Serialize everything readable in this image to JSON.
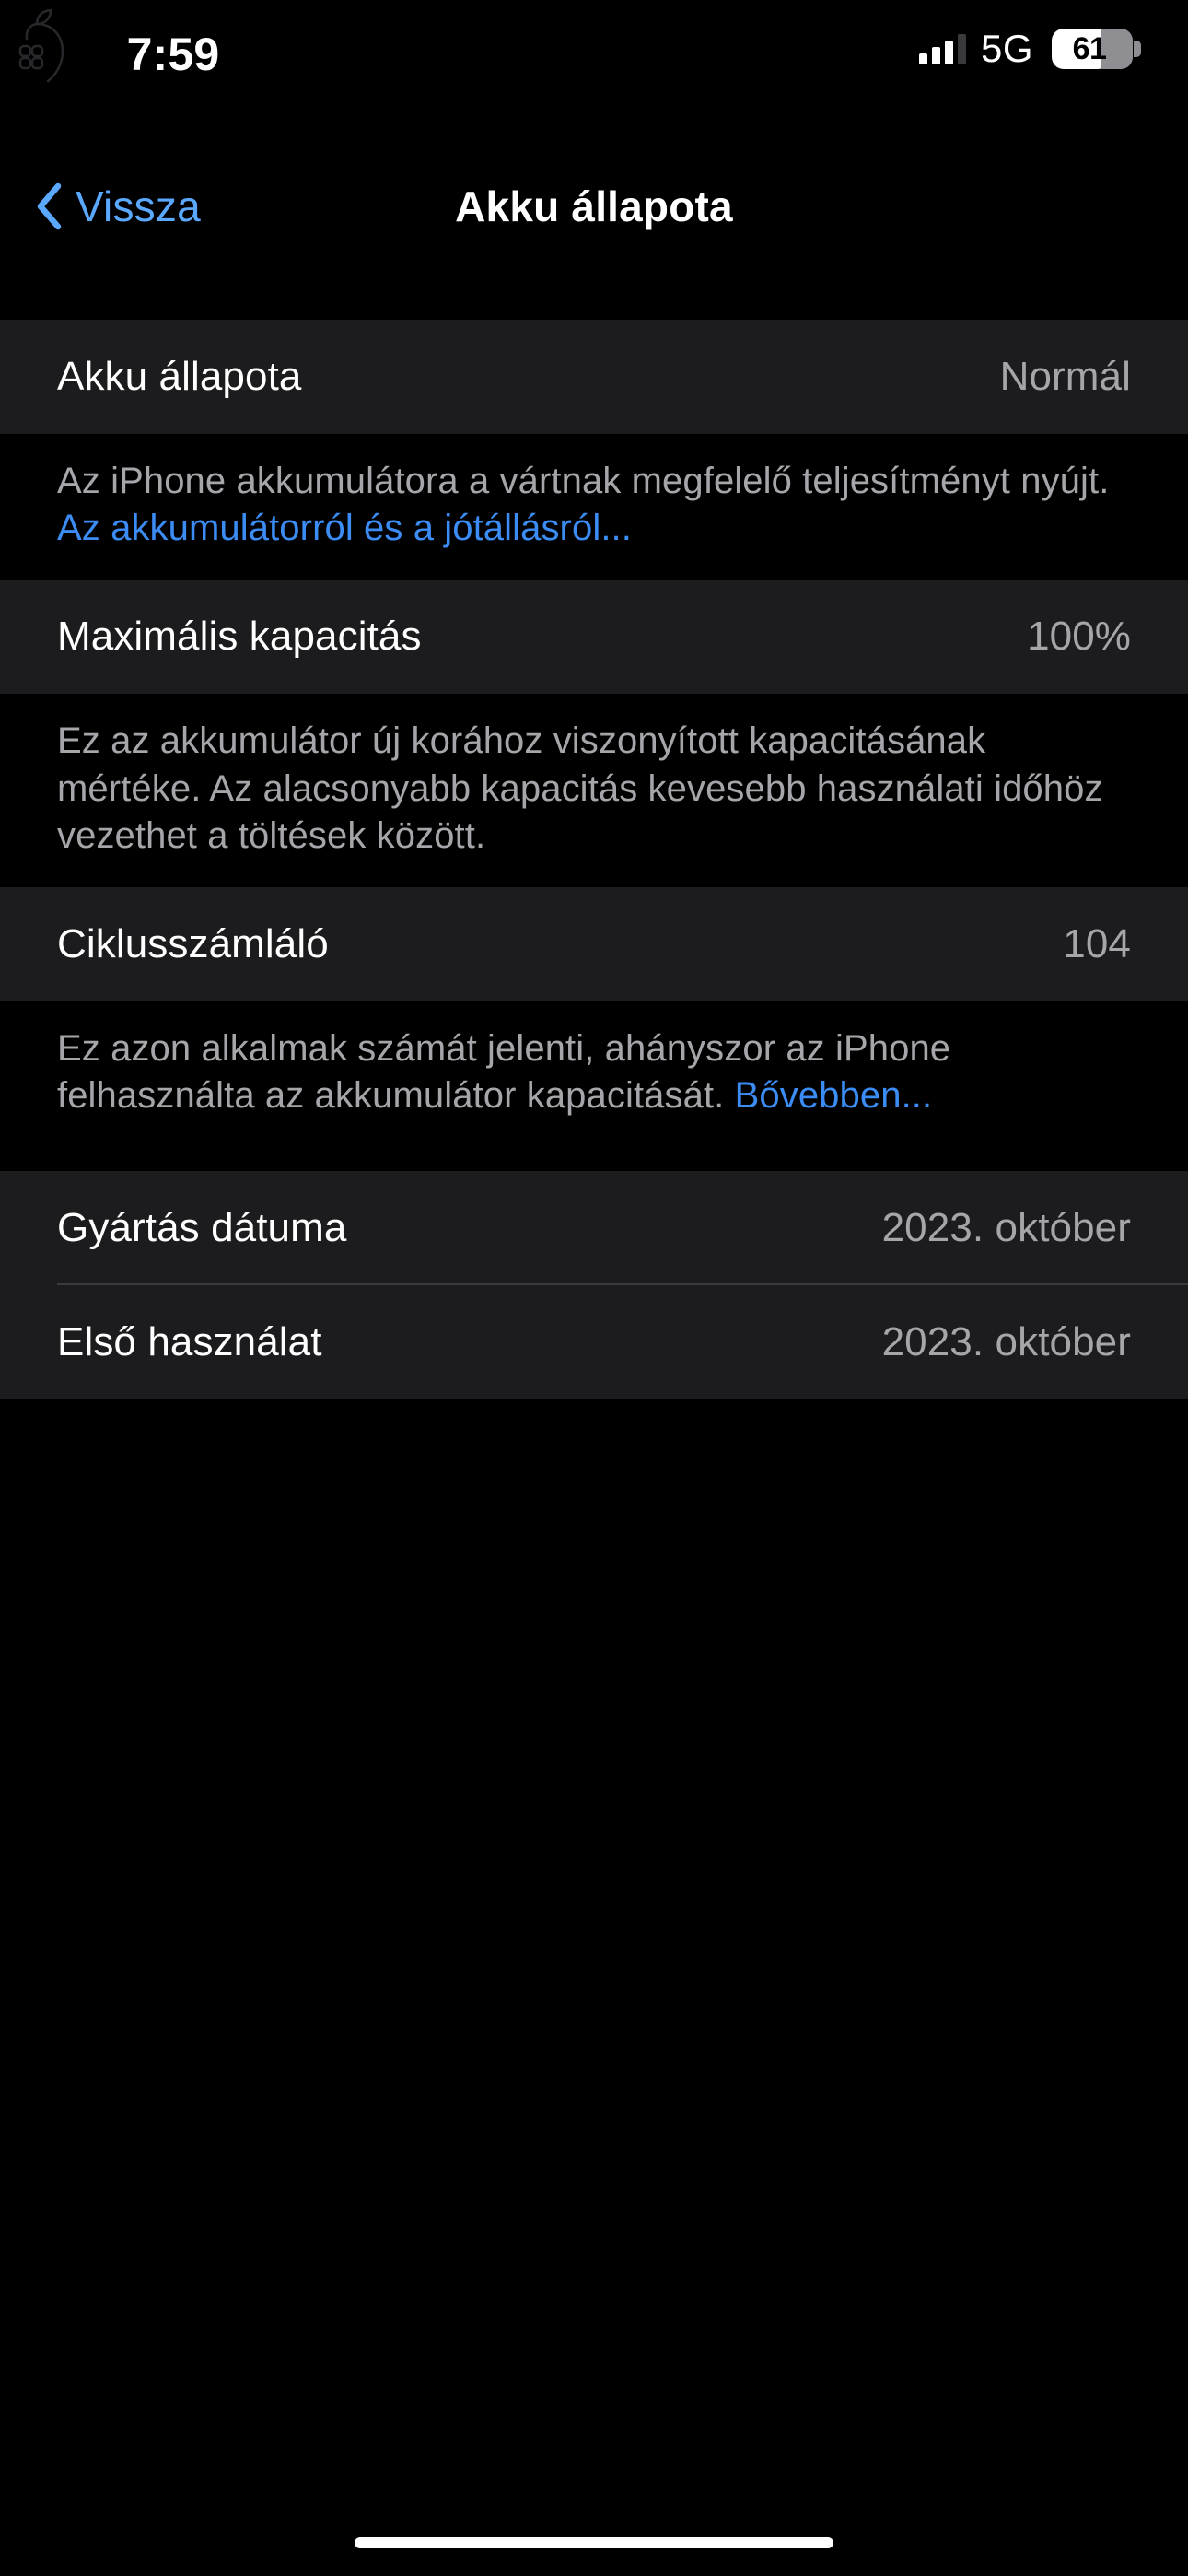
{
  "status_bar": {
    "time": "7:59",
    "network": "5G",
    "battery_percent": "61",
    "battery_level": 61,
    "signal_bars_active": 3,
    "signal_bars_total": 4,
    "watermark_icon": "apple-command-logo"
  },
  "nav": {
    "back_label": "Vissza",
    "back_icon": "chevron-left-icon",
    "title": "Akku állapota",
    "accent_color": "#5aa9ff"
  },
  "sections": {
    "battery_health": {
      "row": {
        "label": "Akku állapota",
        "value": "Normál"
      },
      "footer_text": "Az iPhone akkumulátora a vártnak megfelelő teljesítményt nyújt. ",
      "footer_link": "Az akkumulátorról és a jótállásról..."
    },
    "max_capacity": {
      "row": {
        "label": "Maximális kapacitás",
        "value": "100%"
      },
      "footer_text": "Ez az akkumulátor új korához viszonyított kapacitásának mértéke. Az alacsonyabb kapacitás kevesebb használati időhöz vezethet a töltések között."
    },
    "cycle_count": {
      "row": {
        "label": "Ciklusszámláló",
        "value": "104"
      },
      "footer_text": "Ez azon alkalmak számát jelenti, ahányszor az iPhone felhasználta az akkumulátor kapacitását. ",
      "footer_link": "Bővebben..."
    },
    "dates": {
      "rows": [
        {
          "label": "Gyártás dátuma",
          "value": "2023. október"
        },
        {
          "label": "Első használat",
          "value": "2023. október"
        }
      ]
    }
  },
  "colors": {
    "background": "#000000",
    "cell": "#1c1c1e",
    "separator": "#3a3a3c",
    "secondary_text": "#a5a5aa",
    "link": "#3b8cf4"
  },
  "home_indicator": {
    "visible": true
  }
}
